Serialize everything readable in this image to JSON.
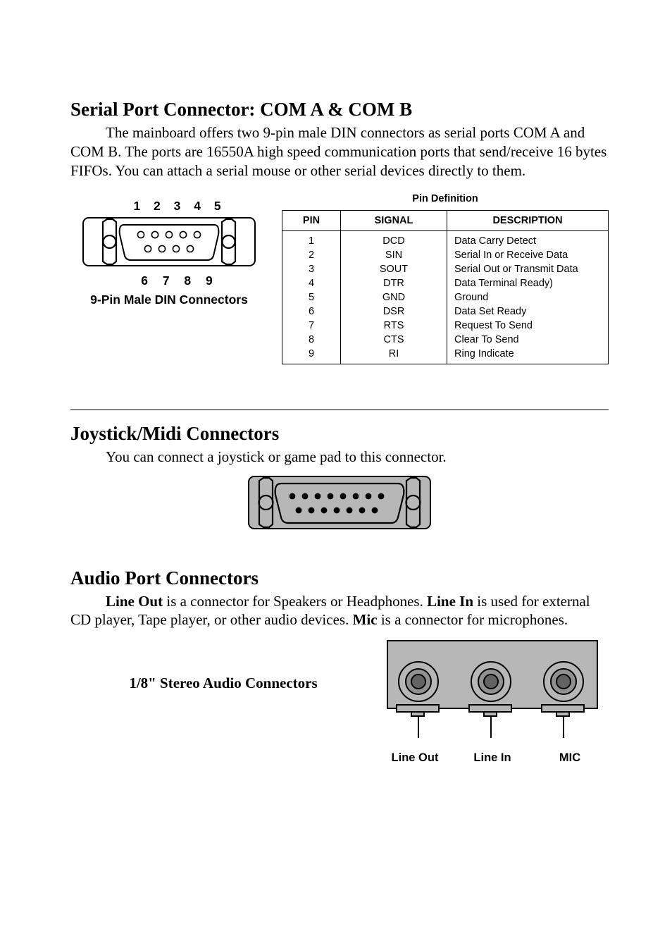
{
  "serial": {
    "heading": "Serial Port Connector: COM A & COM B",
    "paragraph": "The mainboard offers two 9-pin male DIN connectors as serial ports COM A and COM B. The ports are 16550A high speed communication ports that send/receive 16 bytes FIFOs. You can attach a serial mouse or other serial devices directly to them.",
    "pin_top_labels": "1 2 3 4 5",
    "pin_bottom_labels": "6 7 8 9",
    "connector_caption": "9-Pin Male DIN Connectors",
    "table_title": "Pin Definition",
    "headers": [
      "PIN",
      "SIGNAL",
      "DESCRIPTION"
    ],
    "rows": [
      {
        "pin": "1",
        "signal": "DCD",
        "desc": "Data Carry Detect"
      },
      {
        "pin": "2",
        "signal": "SIN",
        "desc": "Serial In or Receive Data"
      },
      {
        "pin": "3",
        "signal": "SOUT",
        "desc": "Serial Out or Transmit Data"
      },
      {
        "pin": "4",
        "signal": "DTR",
        "desc": "Data Terminal Ready)"
      },
      {
        "pin": "5",
        "signal": "GND",
        "desc": "Ground"
      },
      {
        "pin": "6",
        "signal": "DSR",
        "desc": "Data Set Ready"
      },
      {
        "pin": "7",
        "signal": "RTS",
        "desc": "Request To Send"
      },
      {
        "pin": "8",
        "signal": "CTS",
        "desc": "Clear To Send"
      },
      {
        "pin": "9",
        "signal": "RI",
        "desc": "Ring Indicate"
      }
    ]
  },
  "joystick": {
    "heading": "Joystick/Midi Connectors",
    "paragraph": "You can connect a joystick or game pad to this connector."
  },
  "audio": {
    "heading": "Audio Port Connectors",
    "para_prefix1": "Line Out",
    "para_mid1": " is a connector for Speakers or Headphones.  ",
    "para_prefix2": "Line In",
    "para_mid2": " is used for external CD player, Tape player, or other audio devices.  ",
    "para_prefix3": "Mic",
    "para_mid3": " is a connector for microphones.",
    "stereo_caption": "1/8\" Stereo Audio Connectors",
    "labels": {
      "lineout": "Line Out",
      "linein": "Line In",
      "mic": "MIC"
    }
  }
}
